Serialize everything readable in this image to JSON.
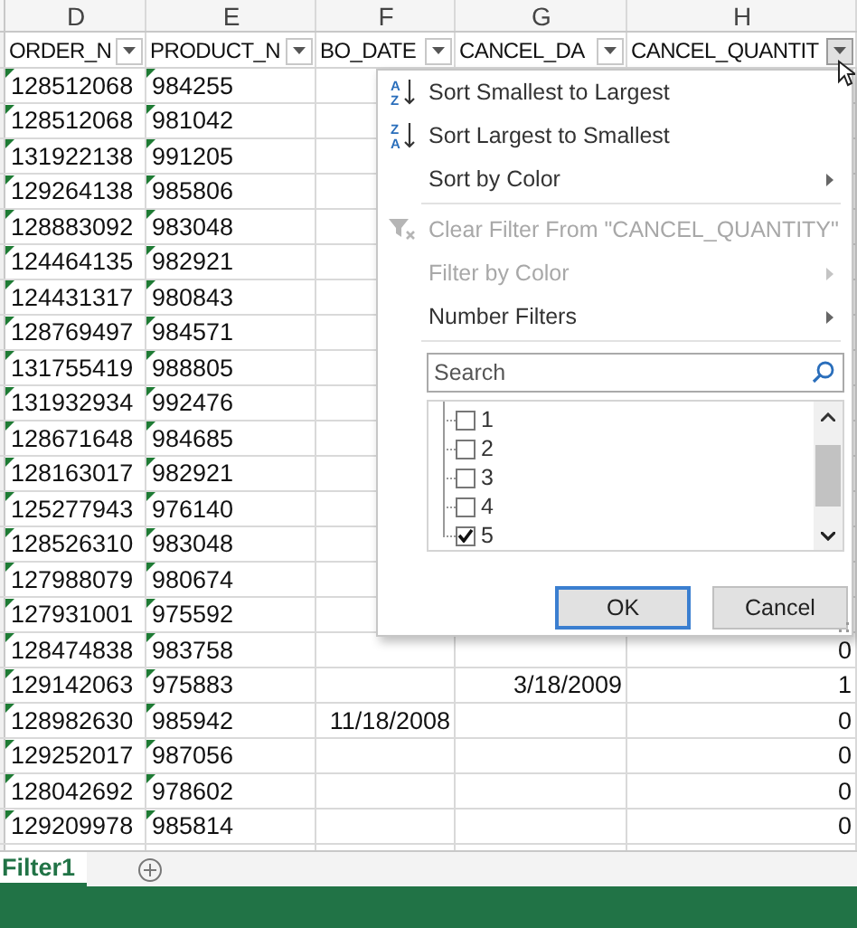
{
  "columns": [
    {
      "letter": "D",
      "header": "ORDER_N",
      "kind": "text",
      "filter_open": false
    },
    {
      "letter": "E",
      "header": "PRODUCT_N",
      "kind": "text",
      "filter_open": false
    },
    {
      "letter": "F",
      "header": "BO_DATE",
      "kind": "date",
      "filter_open": false
    },
    {
      "letter": "G",
      "header": "CANCEL_DA",
      "kind": "date",
      "filter_open": false
    },
    {
      "letter": "H",
      "header": "CANCEL_QUANTIT",
      "kind": "number",
      "filter_open": true
    }
  ],
  "rows": [
    {
      "cells": [
        "128512068",
        "984255"
      ]
    },
    {
      "cells": [
        "128512068",
        "981042"
      ]
    },
    {
      "cells": [
        "131922138",
        "991205"
      ]
    },
    {
      "cells": [
        "129264138",
        "985806"
      ]
    },
    {
      "cells": [
        "128883092",
        "983048"
      ]
    },
    {
      "cells": [
        "124464135",
        "982921"
      ]
    },
    {
      "cells": [
        "124431317",
        "980843"
      ]
    },
    {
      "cells": [
        "128769497",
        "984571"
      ]
    },
    {
      "cells": [
        "131755419",
        "988805"
      ]
    },
    {
      "cells": [
        "131932934",
        "992476"
      ]
    },
    {
      "cells": [
        "128671648",
        "984685"
      ]
    },
    {
      "cells": [
        "128163017",
        "982921"
      ]
    },
    {
      "cells": [
        "125277943",
        "976140"
      ]
    },
    {
      "cells": [
        "128526310",
        "983048"
      ]
    },
    {
      "cells": [
        "127988079",
        "980674"
      ]
    },
    {
      "cells": [
        "127931001",
        "975592"
      ]
    },
    {
      "cells": [
        "128474838",
        "983758",
        null,
        null,
        "0"
      ]
    },
    {
      "cells": [
        "129142063",
        "975883",
        null,
        "3/18/2009",
        "1"
      ]
    },
    {
      "cells": [
        "128982630",
        "985942",
        "11/18/2008",
        null,
        "0"
      ]
    },
    {
      "cells": [
        "129252017",
        "987056",
        null,
        null,
        "0"
      ]
    },
    {
      "cells": [
        "128042692",
        "978602",
        null,
        null,
        "0"
      ]
    },
    {
      "cells": [
        "129209978",
        "985814",
        null,
        null,
        "0"
      ]
    }
  ],
  "filter_menu": {
    "items": [
      {
        "kind": "sort",
        "icon_letters": [
          "A",
          "Z"
        ],
        "label": "Sort Smallest to Largest",
        "disabled": false,
        "submenu": false,
        "separator_after": false
      },
      {
        "kind": "sort",
        "icon_letters": [
          "Z",
          "A"
        ],
        "label": "Sort Largest to Smallest",
        "disabled": false,
        "submenu": false,
        "separator_after": false
      },
      {
        "kind": "plain",
        "label": "Sort by Color",
        "disabled": false,
        "submenu": true,
        "separator_after": true
      },
      {
        "kind": "clear_filter",
        "label": "Clear Filter From \"CANCEL_QUANTITY\"",
        "disabled": true,
        "submenu": false,
        "separator_after": false
      },
      {
        "kind": "plain",
        "label": "Filter by Color",
        "disabled": true,
        "submenu": true,
        "separator_after": false
      },
      {
        "kind": "plain",
        "label": "Number Filters",
        "disabled": false,
        "submenu": true,
        "separator_after": true
      }
    ],
    "search": {
      "placeholder": "Search"
    },
    "values": [
      {
        "label": "1",
        "checked": false
      },
      {
        "label": "2",
        "checked": false
      },
      {
        "label": "3",
        "checked": false
      },
      {
        "label": "4",
        "checked": false
      },
      {
        "label": "5",
        "checked": true
      }
    ],
    "buttons": [
      {
        "label": "OK",
        "focused": true
      },
      {
        "label": "Cancel",
        "focused": false
      }
    ]
  },
  "sheet_tabs": [
    {
      "label": "Filter1",
      "selected": true
    }
  ]
}
